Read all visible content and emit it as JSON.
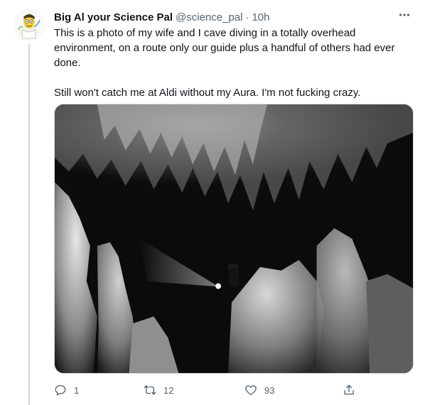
{
  "tweet": {
    "author": {
      "display_name": "Big Al your Science Pal",
      "handle": "@science_pal",
      "separator": "·",
      "time": "10h"
    },
    "text_paragraphs": [
      "This is a photo of my wife and I cave diving in a totally overhead environment, on a route only our guide plus a handful of others had ever done.",
      "Still won't catch me at Aldi without my Aura. I'm not fucking crazy."
    ],
    "actions": {
      "replies": "1",
      "retweets": "12",
      "likes": "93"
    },
    "icons": {
      "more": "more-icon",
      "reply": "reply-icon",
      "retweet": "retweet-icon",
      "like": "heart-icon",
      "share": "share-icon"
    }
  }
}
